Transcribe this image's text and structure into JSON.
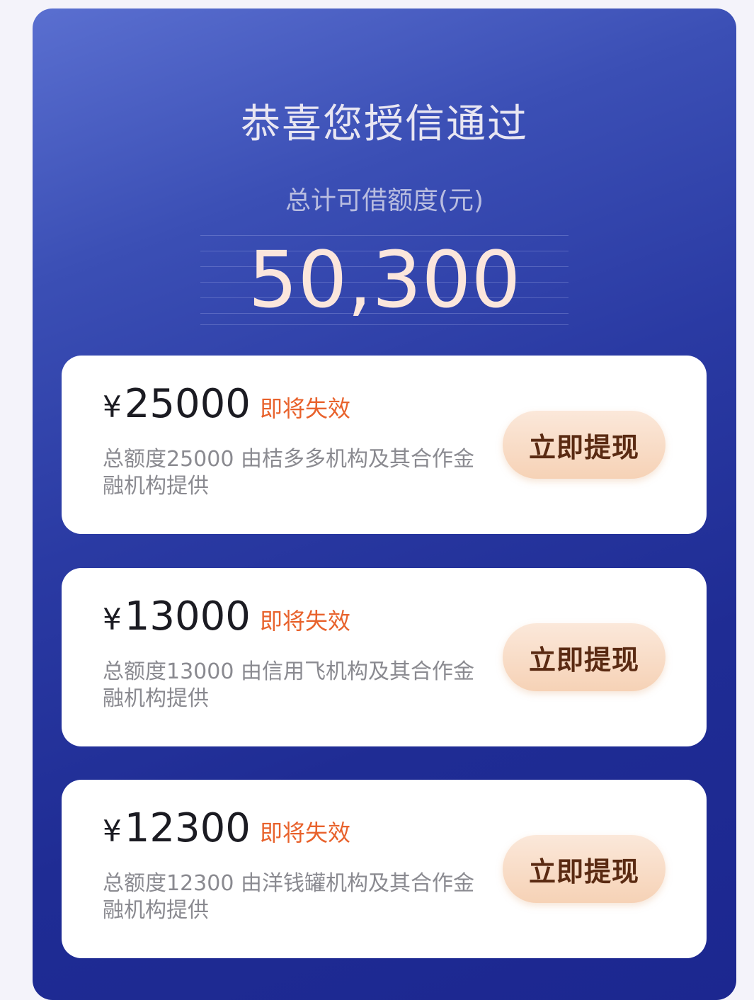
{
  "header": {
    "title": "恭喜您授信通过",
    "subtitle": "总计可借额度(元)",
    "total_amount": "50,300"
  },
  "colors": {
    "panel_bg": "#2a3aa3",
    "amount_text": "#fbe6dc",
    "tag_text": "#e8622c",
    "button_bg": "#f6d2b6"
  },
  "offers": [
    {
      "currency": "¥",
      "amount": "25000",
      "tag": "即将失效",
      "description": "总额度25000 由桔多多机构及其合作金融机构提供",
      "button_label": "立即提现"
    },
    {
      "currency": "¥",
      "amount": "13000",
      "tag": "即将失效",
      "description": "总额度13000 由信用飞机构及其合作金融机构提供",
      "button_label": "立即提现"
    },
    {
      "currency": "¥",
      "amount": "12300",
      "tag": "即将失效",
      "description": "总额度12300 由洋钱罐机构及其合作金融机构提供",
      "button_label": "立即提现"
    }
  ]
}
